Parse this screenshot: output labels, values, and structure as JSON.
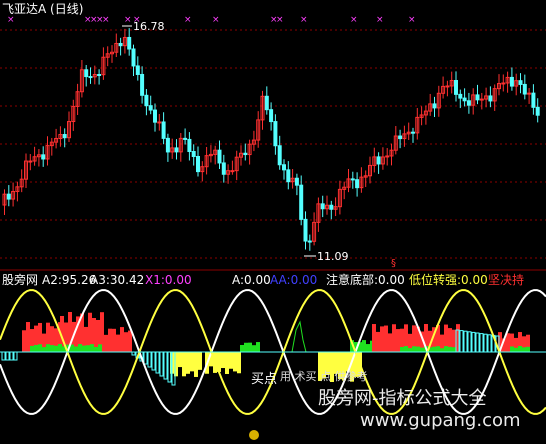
{
  "top_panel": {
    "title": "飞亚达A (日线)",
    "high_label": "16.78",
    "low_label": "11.09",
    "marker_glyph": "§"
  },
  "bottom_panel": {
    "indicator_name": "股旁网",
    "a2": "A2:95.26",
    "a3": "A3:30.42",
    "x1": "X1:0.00",
    "a": "A:0.00",
    "aa": "AA:0.00",
    "bottom_note": "注意底部:0.00",
    "strong": "低位转强:0.00",
    "hold": "坚决持",
    "buy_text": "买",
    "point_text": "点",
    "hint_text": "用 术买 点 供参考"
  },
  "watermark": {
    "line1": "股旁网-指标公式大全",
    "line2": "www.gupang.com"
  },
  "colors": {
    "up": "#ff3030",
    "down": "#54ffff",
    "grid": "#8b0000",
    "magenta": "#ff40ff",
    "yellow": "#ffff40",
    "green": "#20e020",
    "white": "#ffffff",
    "blue": "#4040ff"
  }
}
